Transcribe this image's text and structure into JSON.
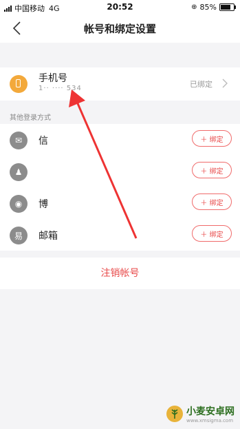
{
  "status_bar": {
    "carrier": "中国移动",
    "network": "4G",
    "time": "20:52",
    "battery": "85%"
  },
  "nav": {
    "title": "帐号和绑定设置",
    "back_icon": "chevron-left-icon"
  },
  "phone": {
    "title": "手机号",
    "number": "1·· ···· 534",
    "status": "已绑定",
    "icon": "phone-icon"
  },
  "section_label": "其他登录方式",
  "accounts": [
    {
      "label": "信",
      "icon": "wechat-icon",
      "button": "＋ 绑定"
    },
    {
      "label": "",
      "icon": "qq-icon",
      "button": "＋ 绑定"
    },
    {
      "label": "博",
      "icon": "weibo-icon",
      "button": "＋ 绑定"
    },
    {
      "label": "邮箱",
      "icon": "mail-icon",
      "button": "＋ 绑定"
    }
  ],
  "logout_label": "注销帐号",
  "watermark": {
    "name": "小麦安卓网",
    "url": "www.xmsigma.com"
  },
  "colors": {
    "accent": "#e84a4a",
    "phone_icon": "#f3a93b",
    "social_icon": "#8c8c8c"
  }
}
